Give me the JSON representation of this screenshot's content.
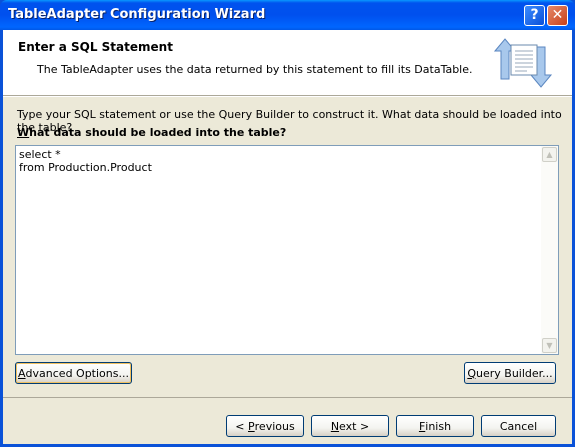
{
  "window": {
    "title": "TableAdapter Configuration Wizard",
    "help_label": "?",
    "close_label": "✕"
  },
  "banner": {
    "title": "Enter a SQL Statement",
    "subtitle": "The TableAdapter uses the data returned by this statement to fill its DataTable."
  },
  "content": {
    "instruction": "Type your SQL statement or use the Query Builder to construct it. What data should be loaded into the table?",
    "question_accel": "W",
    "question_rest": "hat data should be loaded into the table?",
    "sql_text": "select *\nfrom Production.Product"
  },
  "buttons": {
    "advanced_accel": "A",
    "advanced_rest": "dvanced Options...",
    "query_builder_accel": "Q",
    "query_builder_rest": "uery Builder...",
    "previous_prefix": "< ",
    "previous_accel": "P",
    "previous_rest": "revious",
    "next_accel": "N",
    "next_rest": "ext >",
    "finish_accel": "F",
    "finish_rest": "inish",
    "cancel_label": "Cancel"
  },
  "colors": {
    "title_bar": "#0053ee",
    "dialog_face": "#ece9d8",
    "input_border": "#7f9db9"
  }
}
